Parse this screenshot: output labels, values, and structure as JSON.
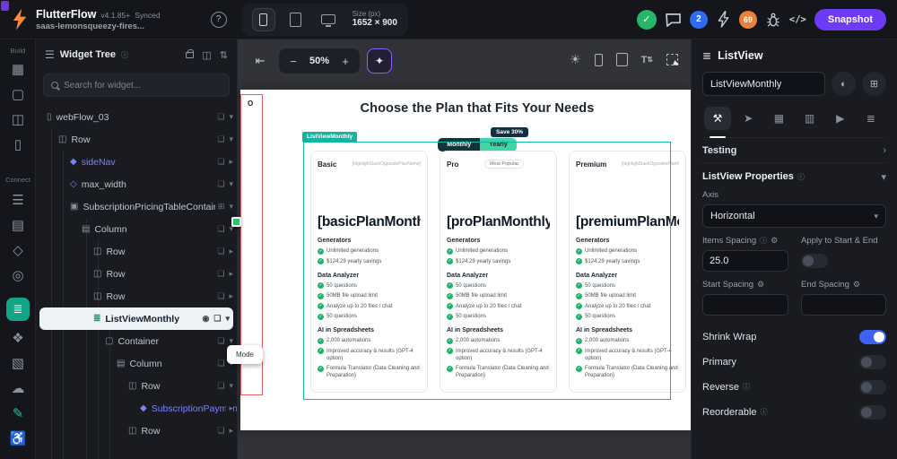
{
  "glyphs": {
    "help": "?",
    "check": "✓",
    "code": "</>",
    "minus": "−",
    "plus": "+",
    "collapse": "⇤",
    "wand": "✦",
    "sun": "☀",
    "caret_down": "▾",
    "caret_right": "▸",
    "chevron_right": "›",
    "info": "ⓘ",
    "gear": "⚙",
    "eye": "◉",
    "copy": "❏",
    "tree_header": "☰",
    "panels": "◫",
    "filter": "⇅",
    "tab_props": "⚒",
    "tab_cursor": "➤",
    "tab_table": "▦",
    "tab_align": "▥",
    "tab_play": "▶",
    "tab_doc": "≣",
    "palette": "◐",
    "widgetize": "⊞",
    "badge_grid": "⊞"
  },
  "topbar": {
    "app_name": "FlutterFlow",
    "version": "v4.1.85+",
    "sync_status": "Synced",
    "project_name": "saas-lemonsqueezy-fires...",
    "size_label": "Size (px)",
    "size_value": "1652 × 900",
    "notifications_badge": "2",
    "issues_badge": "69",
    "snapshot_label": "Snapshot"
  },
  "left_rail": {
    "build_label": "Build",
    "connect_label": "Connect",
    "icons": [
      {
        "name": "dashboard",
        "glyph": "▦"
      },
      {
        "name": "pages",
        "glyph": "▢"
      },
      {
        "name": "components",
        "glyph": "◫"
      },
      {
        "name": "device-preview",
        "glyph": "▯"
      },
      {
        "name": "database",
        "glyph": "☰"
      },
      {
        "name": "data-schema",
        "glyph": "▤"
      },
      {
        "name": "api-calls",
        "glyph": "◇"
      },
      {
        "name": "app-state",
        "glyph": "◎"
      },
      {
        "name": "widget-tree-active",
        "glyph": "≣"
      },
      {
        "name": "team",
        "glyph": "❖"
      },
      {
        "name": "media-assets",
        "glyph": "▧"
      },
      {
        "name": "cloud-functions",
        "glyph": "☁"
      },
      {
        "name": "theme-editor",
        "glyph": "✎"
      },
      {
        "name": "accessibility",
        "glyph": "♿"
      }
    ]
  },
  "widget_tree": {
    "title": "Widget Tree",
    "search_placeholder": "Search for widget...",
    "items": [
      {
        "label": "webFlow_03",
        "icon": "▯"
      },
      {
        "label": "Row",
        "icon": "◫"
      },
      {
        "label": "sideNav",
        "icon": "◆"
      },
      {
        "label": "max_width",
        "icon": "◇"
      },
      {
        "label": "SubscriptionPricingTableContainer",
        "icon": "▣"
      },
      {
        "label": "Column",
        "icon": "▤"
      },
      {
        "label": "Row",
        "icon": "◫"
      },
      {
        "label": "Row",
        "icon": "◫"
      },
      {
        "label": "Row",
        "icon": "◫"
      },
      {
        "label": "ListViewMonthly",
        "icon": "≣"
      },
      {
        "label": "Container",
        "icon": "▢"
      },
      {
        "label": "Column",
        "icon": "▤"
      },
      {
        "label": "Row",
        "icon": "◫"
      },
      {
        "label": "SubscriptionPaymentTileMon",
        "icon": "◆"
      },
      {
        "label": "Row",
        "icon": "◫"
      }
    ]
  },
  "canvas": {
    "zoom_level": "50%",
    "selection_tag": "ListViewMonthly",
    "mode_popup": "Mode",
    "strip_logo": "O",
    "page": {
      "heading": "Choose the Plan that Fits Your Needs",
      "save_badge": "Save 30%",
      "monthly": "Monthly",
      "yearly": "Yearly",
      "sash_placeholder": "[highlightSashOppositePlanName]",
      "cards": [
        {
          "plan": "Basic",
          "price": "[basicPlanMonthly"
        },
        {
          "plan": "Pro",
          "badge": "Most Popular",
          "price": "[proPlanMonthlyPr"
        },
        {
          "plan": "Premium",
          "price": "[premiumPlanMo"
        }
      ],
      "sections": [
        {
          "title": "Generators",
          "items": [
            "Unlimited generations",
            "$124.29 yearly savings"
          ]
        },
        {
          "title": "Data Analyzer",
          "items": [
            "50 questions",
            "50MB file upload limit",
            "Analyze up to 20 files / chat",
            "50 questions"
          ]
        },
        {
          "title": "AI in Spreadsheets",
          "items": [
            "2,000 automations",
            "Improved accuracy & results (GPT-4 option)",
            "Formula Translator (Data Cleaning and Preparation)"
          ]
        }
      ]
    }
  },
  "inspector": {
    "widget_type": "ListView",
    "name_value": "ListViewMonthly",
    "testing_label": "Testing",
    "properties_label": "ListView Properties",
    "axis_label": "Axis",
    "axis_value": "Horizontal",
    "items_spacing_label": "Items Spacing",
    "items_spacing_value": "25.0",
    "apply_start_end_label": "Apply to Start & End",
    "start_spacing_label": "Start Spacing",
    "end_spacing_label": "End Spacing",
    "shrink_wrap_label": "Shrink Wrap",
    "primary_label": "Primary",
    "reverse_label": "Reverse",
    "reorderable_label": "Reorderable"
  }
}
